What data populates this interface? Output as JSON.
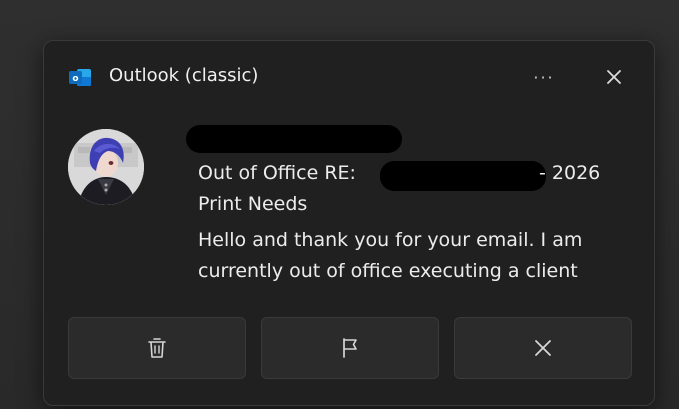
{
  "notification": {
    "app_name": "Outlook (classic)",
    "header_icons": {
      "more": "more-options-icon",
      "close": "close-icon"
    },
    "more_label": "···",
    "message": {
      "subject_prefix": "Out of Office RE:",
      "subject_suffix": "- 2026",
      "subject_line2": "Print Needs",
      "preview": "Hello and thank you for your email. I am currently out of office executing a client"
    },
    "actions": [
      {
        "name": "delete",
        "icon": "trash-icon"
      },
      {
        "name": "flag",
        "icon": "flag-icon"
      },
      {
        "name": "dismiss",
        "icon": "close-icon"
      }
    ],
    "colors": {
      "background": "#202020",
      "button": "#2b2b2b",
      "text": "#ececec",
      "outlook_blue": "#0f6cbd"
    }
  }
}
